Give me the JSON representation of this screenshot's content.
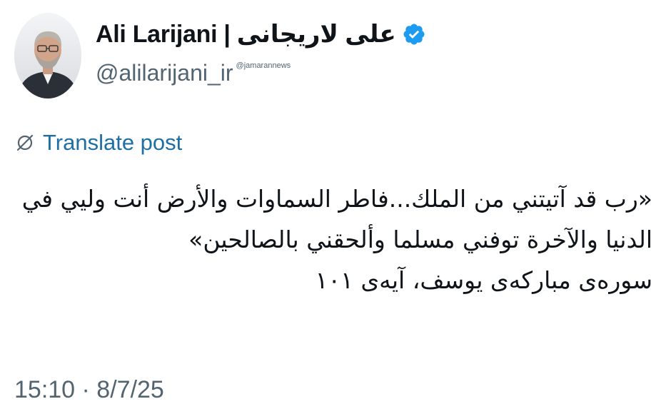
{
  "author": {
    "display_name": "Ali Larijani | علی لاریجانی",
    "handle": "@alilarijani_ir",
    "verified": true,
    "avatar_icon": "profile-photo"
  },
  "watermark": "@jamarannews",
  "translate": {
    "label": "Translate post",
    "icon": "globe-slash-icon"
  },
  "post": {
    "lines": [
      "«رب قد آتيتني من الملك...فاطر السماوات والأرض أنت وليي في",
      "الدنيا والآخرة توفني مسلما وألحقني بالصالحين»",
      "سوره‌ی مبارکه‌ی یوسف، آیه‌ی ۱۰۱"
    ]
  },
  "timestamp": "15:10 · 8/7/25",
  "colors": {
    "text": "#0f1419",
    "secondary": "#536471",
    "link": "#1d6fa5",
    "verified": "#1d9bf0"
  }
}
